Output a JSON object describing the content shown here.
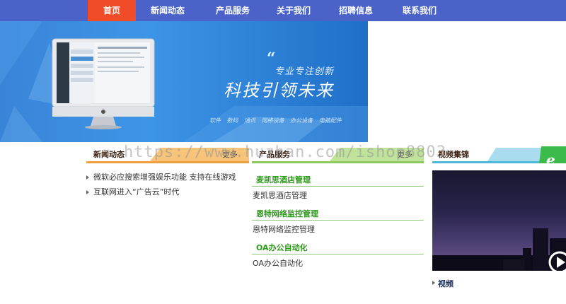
{
  "nav": {
    "items": [
      {
        "label": "首页",
        "active": true
      },
      {
        "label": "新闻动态"
      },
      {
        "label": "产品服务"
      },
      {
        "label": "关于我们"
      },
      {
        "label": "招聘信息"
      },
      {
        "label": "联系我们"
      }
    ]
  },
  "banner": {
    "quote_mark": "“",
    "subtitle": "专业专注创新",
    "title": "科技引领未来",
    "tags": "软件 数码 通讯 网络设备 办公设备 电脑配件"
  },
  "news": {
    "title": "新闻动态",
    "more": "更多",
    "items": [
      "微软必应搜索增强娱乐功能 支持在线游戏",
      "互联网进入“广告云”时代"
    ]
  },
  "products": {
    "title": "产品服务",
    "more": "更多",
    "categories": [
      {
        "title": "麦凯思酒店管理",
        "item": "麦凯思酒店管理"
      },
      {
        "title": "恩特网络监控管理",
        "item": "恩特网络监控管理"
      },
      {
        "title": "OA办公自动化",
        "item": "OA办公自动化"
      }
    ]
  },
  "video": {
    "title": "视频集锦",
    "caption": "视频"
  },
  "watermark": "https://www.huzhan.com/ishop8803",
  "colors": {
    "nav_bg": "#4b63c8",
    "nav_active": "#f04c28",
    "product_green": "#2f9a1c"
  }
}
